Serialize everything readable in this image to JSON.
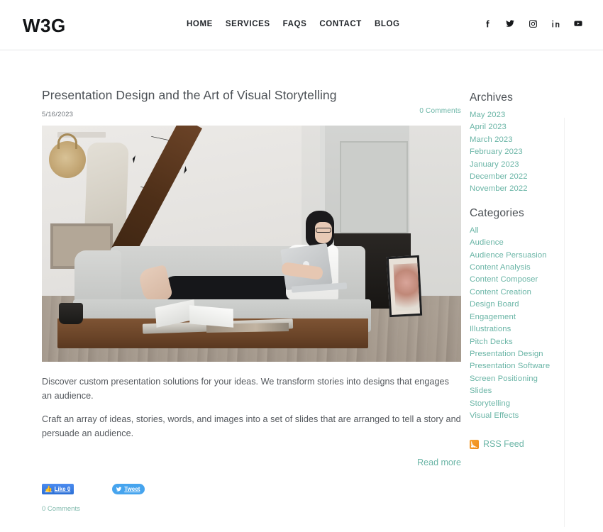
{
  "header": {
    "logo": "W3G",
    "nav": [
      {
        "label": "HOME"
      },
      {
        "label": "SERVICES"
      },
      {
        "label": "FAQS"
      },
      {
        "label": "CONTACT"
      },
      {
        "label": "BLOG"
      }
    ],
    "socials": [
      {
        "name": "facebook-icon"
      },
      {
        "name": "twitter-icon"
      },
      {
        "name": "instagram-icon"
      },
      {
        "name": "linkedin-icon"
      },
      {
        "name": "youtube-icon"
      }
    ]
  },
  "post": {
    "title": "Presentation Design and the Art of Visual Storytelling",
    "date": "5/16/2023",
    "comments_top": "0 Comments",
    "image_alt": "Woman with glasses reclining on a light gray sofa using a laptop in a bright minimalist living room with wooden floor and coffee table",
    "paragraphs": [
      "Discover custom presentation solutions for your ideas. We transform stories into designs that engages an audience.",
      "Craft an array of ideas, stories, words, and images into a set of slides that are arranged to tell a story and persuade an audience."
    ],
    "read_more": "Read more",
    "facebook_like": "Like 0",
    "twitter_share": "Tweet",
    "comments_bottom": "0 Comments"
  },
  "sidebar": {
    "archives_heading": "Archives",
    "archives": [
      {
        "label": "May 2023"
      },
      {
        "label": "April 2023"
      },
      {
        "label": "March 2023"
      },
      {
        "label": "February 2023"
      },
      {
        "label": "January 2023"
      },
      {
        "label": "December 2022"
      },
      {
        "label": "November 2022"
      }
    ],
    "categories_heading": "Categories",
    "categories": [
      {
        "label": "All"
      },
      {
        "label": "Audience"
      },
      {
        "label": "Audience Persuasion"
      },
      {
        "label": "Content Analysis"
      },
      {
        "label": "Content Composer"
      },
      {
        "label": "Content Creation"
      },
      {
        "label": "Design Board"
      },
      {
        "label": "Engagement"
      },
      {
        "label": "Illustrations"
      },
      {
        "label": "Pitch Decks"
      },
      {
        "label": "Presentation Design"
      },
      {
        "label": "Presentation Software"
      },
      {
        "label": "Screen Positioning"
      },
      {
        "label": "Slides"
      },
      {
        "label": "Storytelling"
      },
      {
        "label": "Visual Effects"
      }
    ],
    "rss_label": "RSS Feed"
  },
  "colors": {
    "link_teal": "#6ab5a6",
    "text_dark": "#4c5156",
    "logo_black": "#121416",
    "rss_orange": "#ef8b18",
    "facebook_blue": "#2b6fd6",
    "twitter_blue": "#46a4ee"
  }
}
